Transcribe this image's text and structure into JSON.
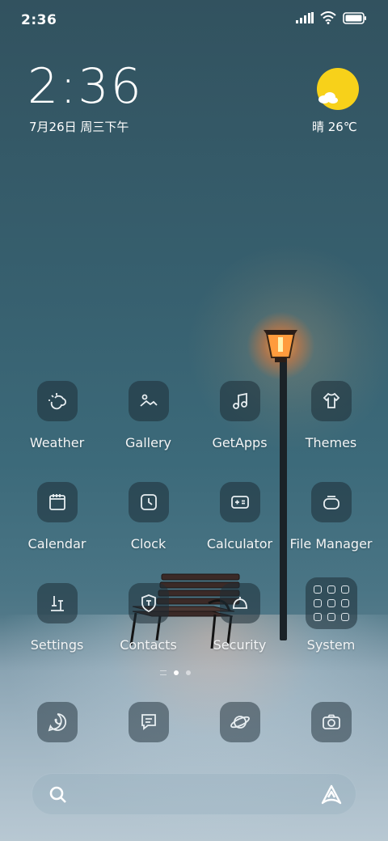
{
  "status_bar": {
    "time": "2:36",
    "icons": [
      "signal-icon",
      "wifi-icon",
      "battery-icon"
    ]
  },
  "clock_widget": {
    "time": "2:36",
    "date": "7月26日 周三下午"
  },
  "weather_widget": {
    "icon": "sun-cloud-icon",
    "text": "晴 26℃"
  },
  "apps": [
    {
      "label": "Weather",
      "icon": "weather-icon"
    },
    {
      "label": "Gallery",
      "icon": "gallery-icon"
    },
    {
      "label": "GetApps",
      "icon": "music-note-icon"
    },
    {
      "label": "Themes",
      "icon": "themes-icon"
    },
    {
      "label": "Calendar",
      "icon": "calendar-icon"
    },
    {
      "label": "Clock",
      "icon": "clock-icon"
    },
    {
      "label": "Calculator",
      "icon": "calculator-icon"
    },
    {
      "label": "File Manager",
      "icon": "file-manager-icon"
    },
    {
      "label": "Settings",
      "icon": "settings-icon"
    },
    {
      "label": "Contacts",
      "icon": "contacts-icon"
    },
    {
      "label": "Security",
      "icon": "security-icon"
    },
    {
      "label": "System",
      "icon": "folder-icon"
    }
  ],
  "page_indicator": {
    "pages": 3,
    "current": 2
  },
  "dock": [
    {
      "icon": "phone-icon"
    },
    {
      "icon": "messages-icon"
    },
    {
      "icon": "browser-icon"
    },
    {
      "icon": "camera-icon"
    }
  ],
  "search_bar": {
    "left_icon": "search-icon",
    "right_icon": "assistant-icon"
  },
  "colors": {
    "sun": "#f7d11a",
    "lamp_glow": "#ff8a3a",
    "tile_bg": "#1e2d37"
  }
}
